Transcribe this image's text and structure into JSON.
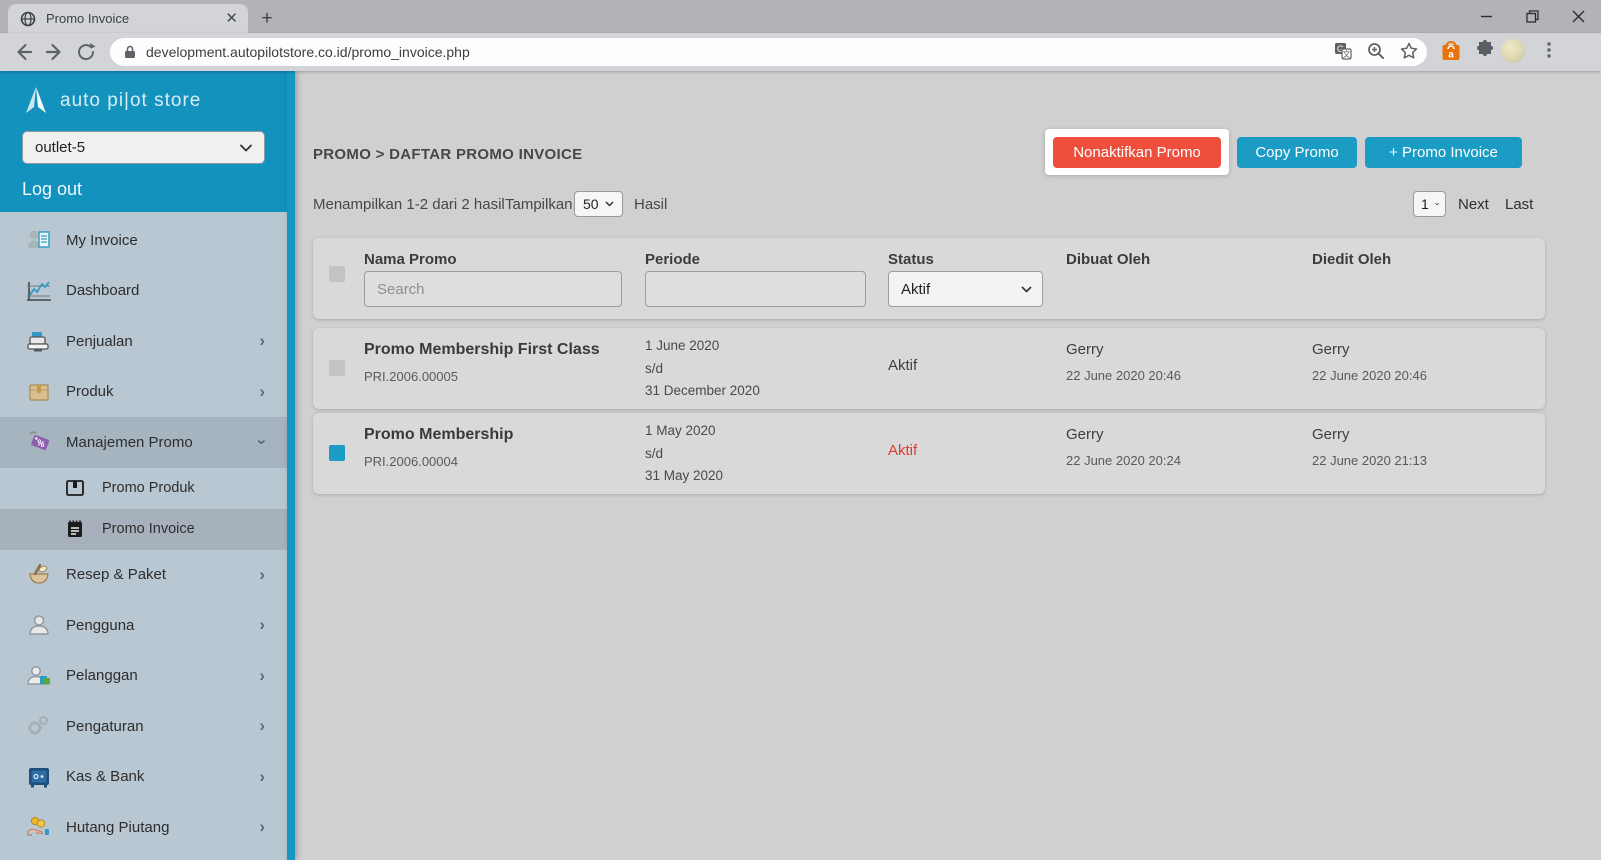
{
  "colors": {
    "accent_teal": "#1b9cc4",
    "sidebar_teal": "#1392bd",
    "danger_red": "#ee4f3c",
    "status_red": "#e0392e",
    "sidebar_bg": "#b9c7d2"
  },
  "browser": {
    "tab_title": "Promo Invoice",
    "url": "development.autopilotstore.co.id/promo_invoice.php"
  },
  "sidebar": {
    "brand": "auto pi|ot store",
    "outlet": "outlet-5",
    "logout_label": "Log out",
    "items": [
      {
        "label": "My Invoice"
      },
      {
        "label": "Dashboard"
      },
      {
        "label": "Penjualan",
        "has_children": true
      },
      {
        "label": "Produk",
        "has_children": true
      },
      {
        "label": "Manajemen Promo",
        "has_children": true,
        "expanded": true
      },
      {
        "label": "Promo Produk",
        "submenu": true
      },
      {
        "label": "Promo Invoice",
        "submenu": true,
        "selected": true
      },
      {
        "label": "Resep & Paket",
        "has_children": true
      },
      {
        "label": "Pengguna",
        "has_children": true
      },
      {
        "label": "Pelanggan",
        "has_children": true
      },
      {
        "label": "Pengaturan",
        "has_children": true
      },
      {
        "label": "Kas & Bank",
        "has_children": true
      },
      {
        "label": "Hutang Piutang",
        "has_children": true
      }
    ]
  },
  "main": {
    "breadcrumb": "PROMO > DAFTAR PROMO INVOICE",
    "actions": {
      "deactivate": "Nonaktifkan Promo",
      "copy": "Copy Promo",
      "add": "+ Promo Invoice"
    },
    "meta": {
      "showing": "Menampilkan 1-2 dari 2 hasil",
      "tampilkan": "Tampilkan",
      "page_size": "50",
      "hasil": "Hasil"
    },
    "pagination": {
      "page": "1",
      "next": "Next",
      "last": "Last"
    },
    "table": {
      "headers": {
        "name": "Nama Promo",
        "period": "Periode",
        "status": "Status",
        "created": "Dibuat Oleh",
        "edited": "Diedit Oleh"
      },
      "filters": {
        "search_placeholder": "Search",
        "status_value": "Aktif"
      },
      "rows": [
        {
          "checked": false,
          "name": "Promo Membership First Class",
          "code": "PRI.2006.00005",
          "period_start": "1 June 2020",
          "period_sep": "s/d",
          "period_end": "31 December 2020",
          "status": "Aktif",
          "status_color": "#3f3f3f",
          "created_by": "Gerry",
          "created_at": "22 June 2020 20:46",
          "edited_by": "Gerry",
          "edited_at": "22 June 2020 20:46"
        },
        {
          "checked": true,
          "name": "Promo Membership",
          "code": "PRI.2006.00004",
          "period_start": "1 May 2020",
          "period_sep": "s/d",
          "period_end": "31 May 2020",
          "status": "Aktif",
          "status_color": "#e0392e",
          "created_by": "Gerry",
          "created_at": "22 June 2020 20:24",
          "edited_by": "Gerry",
          "edited_at": "22 June 2020 21:13"
        }
      ]
    }
  }
}
